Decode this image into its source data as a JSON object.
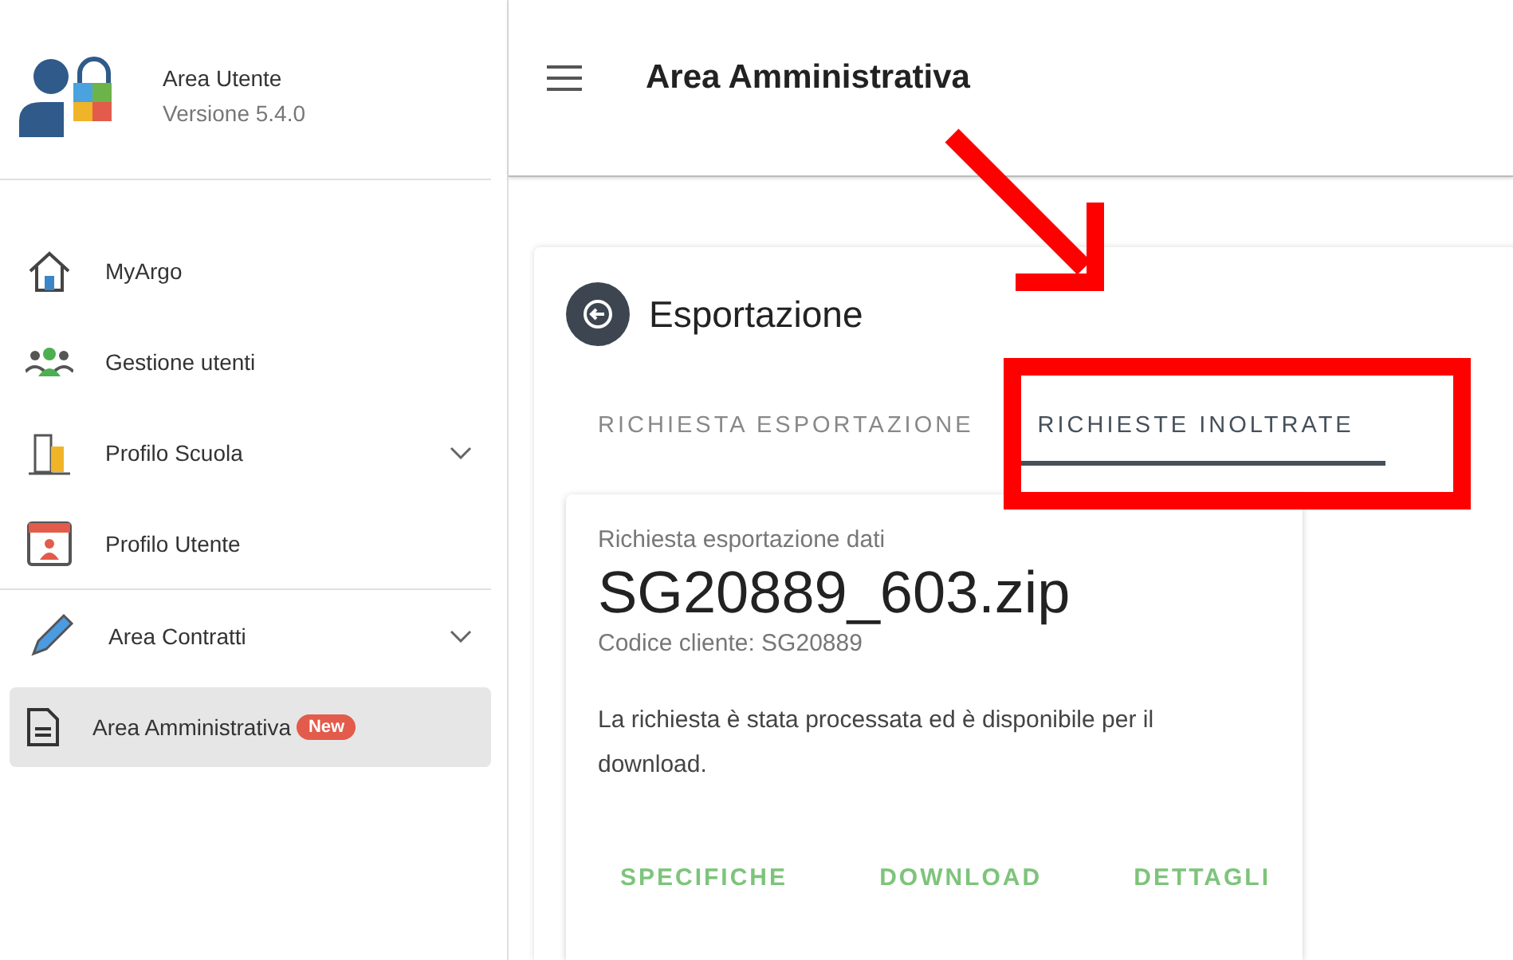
{
  "sidebar": {
    "title": "Area Utente",
    "version": "Versione 5.4.0",
    "groups": [
      [
        {
          "label": "MyArgo",
          "kind": "home",
          "expandable": false,
          "selected": false
        },
        {
          "label": "Gestione utenti",
          "kind": "users",
          "expandable": false,
          "selected": false
        },
        {
          "label": "Profilo Scuola",
          "kind": "building",
          "expandable": true,
          "selected": false
        },
        {
          "label": "Profilo Utente",
          "kind": "profile",
          "expandable": false,
          "selected": false
        }
      ],
      [
        {
          "label": "Area Contratti",
          "kind": "pen",
          "expandable": true,
          "selected": false
        },
        {
          "label": "Area Amministrativa",
          "kind": "document",
          "expandable": false,
          "selected": true,
          "badge": "New"
        }
      ]
    ]
  },
  "header": {
    "title": "Area Amministrativa"
  },
  "panel": {
    "title": "Esportazione",
    "tabs": [
      {
        "label": "RICHIESTA ESPORTAZIONE",
        "selected": false
      },
      {
        "label": "RICHIESTE INOLTRATE",
        "selected": true
      }
    ],
    "request": {
      "subtitle": "Richiesta esportazione dati",
      "filename": "SG20889_603.zip",
      "client_code": "Codice cliente: SG20889",
      "message": "La richiesta è stata processata ed è disponibile per il download.",
      "actions": [
        "SPECIFICHE",
        "DOWNLOAD",
        "DETTAGLI"
      ]
    }
  }
}
